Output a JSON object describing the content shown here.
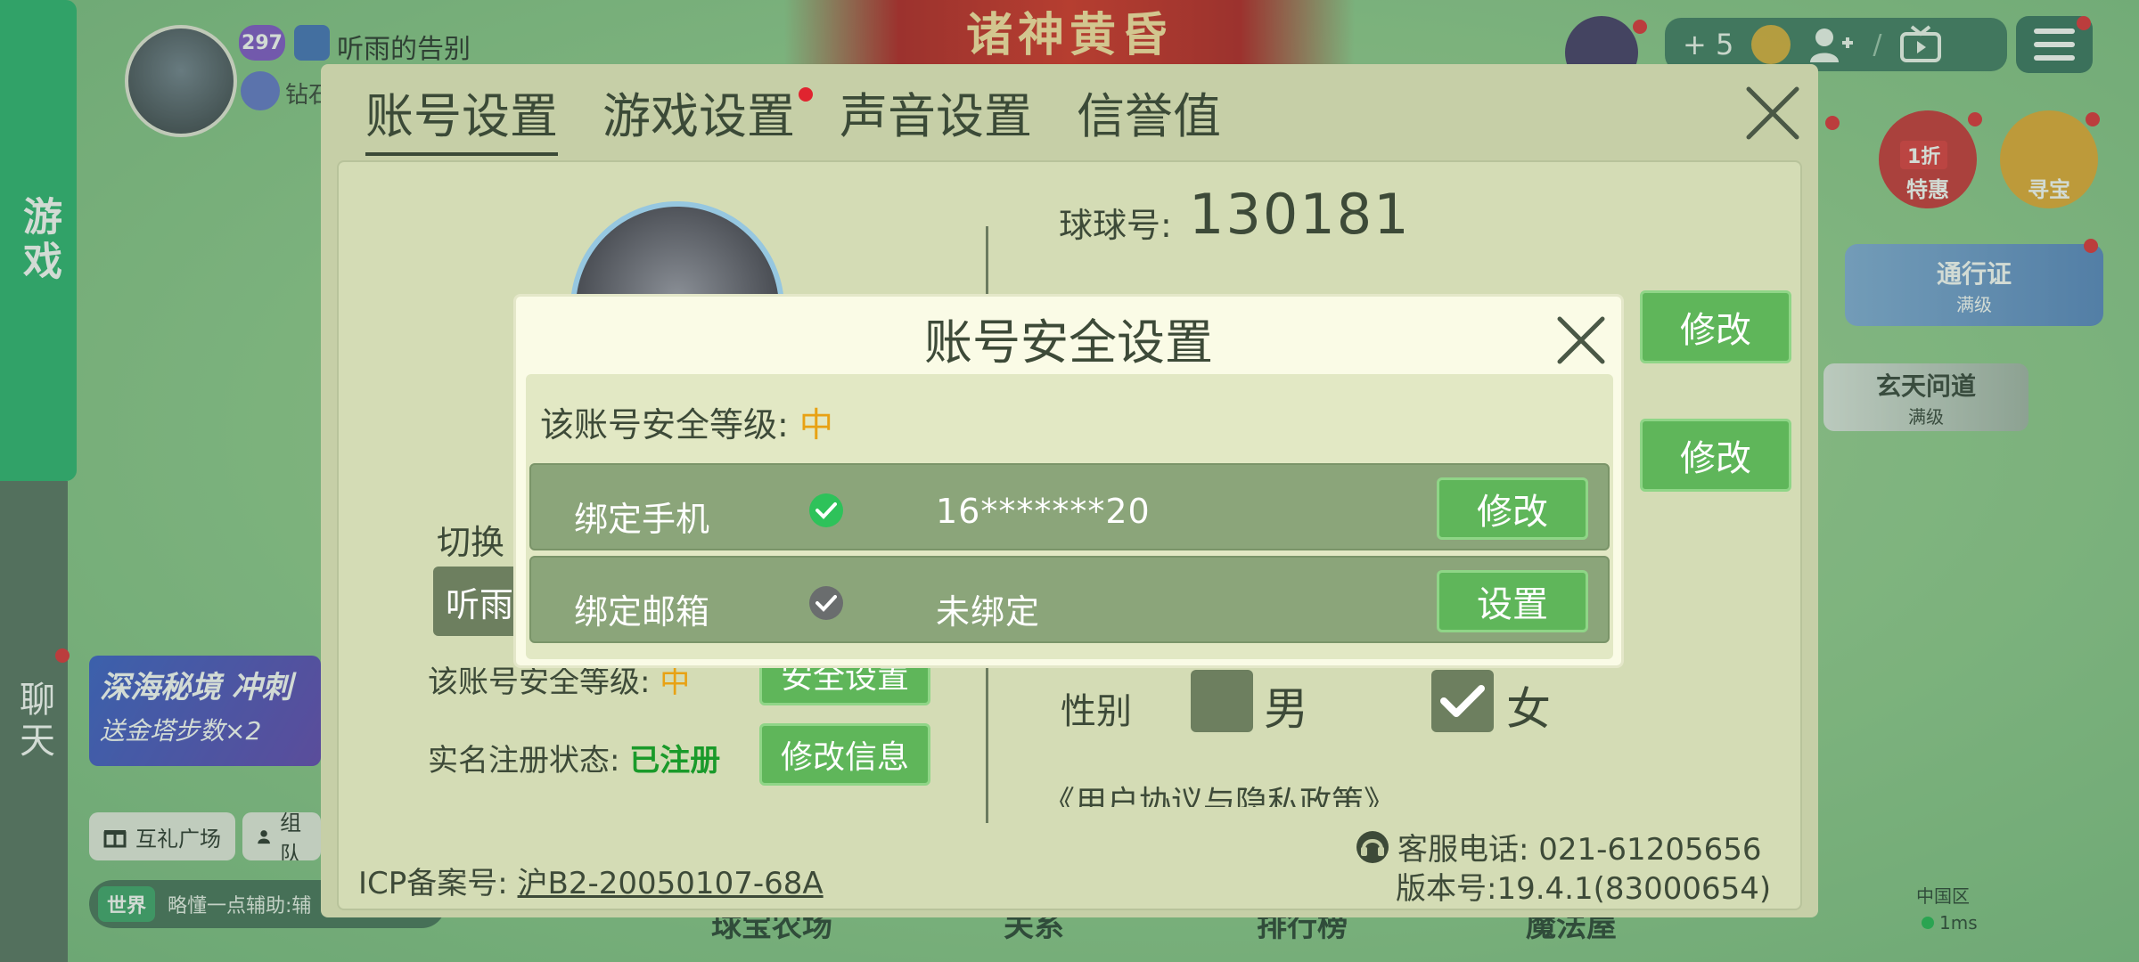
{
  "sidebar": {
    "game_tab": "游戏",
    "chat_tab": "聊天"
  },
  "player": {
    "level": "297",
    "name": "听雨的告别",
    "rank": "钻石"
  },
  "banner": {
    "title": "诸神黄昏"
  },
  "topbar": {
    "plus_count": "+ 5"
  },
  "events": {
    "sale_label": "特惠",
    "sale_badge": "1折",
    "treasure_label": "寻宝"
  },
  "pass": {
    "title": "通行证",
    "sub": "满级"
  },
  "dao": {
    "title": "玄天问道",
    "sub": "满级"
  },
  "promo": {
    "line1": "深海秘境 冲刺",
    "line2": "送金塔步数×2"
  },
  "bottom_tags": {
    "gift": "互礼广场",
    "team": "组队"
  },
  "chat": {
    "tag": "世界",
    "msg": "略懂一点辅助:辅"
  },
  "bottom_nav": [
    "球宝农场",
    "关系",
    "排行榜",
    "魔法屋"
  ],
  "server": {
    "region": "中国区",
    "ping": "1ms"
  },
  "settings": {
    "tabs": [
      "账号设置",
      "游戏设置",
      "声音设置",
      "信誉值"
    ],
    "qq_label": "球球号:",
    "qq_value": "130181",
    "modify_btn": "修改",
    "switch_label": "切换",
    "account_name": "听雨",
    "security_label": "该账号安全等级:",
    "security_level": "中",
    "security_btn": "安全设置",
    "real_label": "实名注册状态:",
    "real_status": "已注册",
    "real_btn": "修改信息",
    "gender_label": "性别",
    "gender_male": "男",
    "gender_female": "女",
    "agreement": "《用户协议与隐私政策》",
    "icp_label": "ICP备案号:",
    "icp_value": "沪B2-20050107-68A",
    "cs_phone": "客服电话: 021-61205656",
    "version": "版本号:19.4.1(83000654)"
  },
  "dialog": {
    "title": "账号安全设置",
    "level_label": "该账号安全等级:",
    "level_value": "中",
    "rows": [
      {
        "label": "绑定手机",
        "value": "16*******20",
        "action": "修改",
        "bound": true
      },
      {
        "label": "绑定邮箱",
        "value": "未绑定",
        "action": "设置",
        "bound": false
      }
    ]
  },
  "colors": {
    "accent_green": "#5fb65a",
    "level_orange": "#e8a214",
    "registered_green": "#1a9a2a"
  }
}
